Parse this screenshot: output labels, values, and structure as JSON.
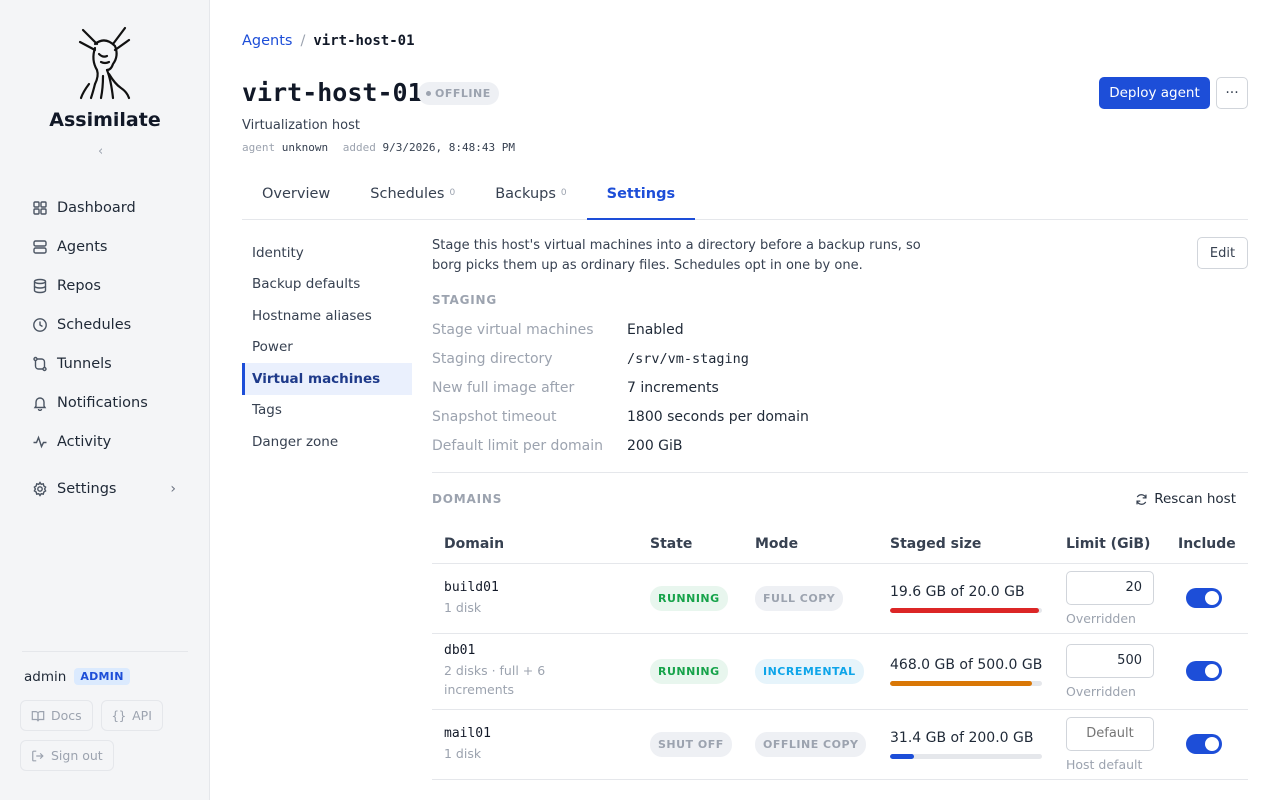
{
  "brand": {
    "name": "Assimilate",
    "collapse_glyph": "‹"
  },
  "sidebar": {
    "items": [
      {
        "label": "Dashboard",
        "icon": "dashboard-icon"
      },
      {
        "label": "Agents",
        "icon": "server-icon"
      },
      {
        "label": "Repos",
        "icon": "database-icon"
      },
      {
        "label": "Schedules",
        "icon": "clock-icon"
      },
      {
        "label": "Tunnels",
        "icon": "tunnel-icon"
      },
      {
        "label": "Notifications",
        "icon": "bell-icon"
      },
      {
        "label": "Activity",
        "icon": "activity-icon"
      },
      {
        "label": "Settings",
        "icon": "gear-icon"
      }
    ],
    "user": {
      "name": "admin",
      "role": "ADMIN"
    },
    "docs_label": "Docs",
    "api_label": "API",
    "signout_label": "Sign out"
  },
  "breadcrumb": {
    "parent": "Agents",
    "separator": "/",
    "current": "virt-host-01"
  },
  "header": {
    "title": "virt-host-01",
    "status": "OFFLINE",
    "subtitle": "Virtualization host",
    "meta": {
      "agent_key": "agent",
      "agent_value": "unknown",
      "added_key": "added",
      "added_value": "9/3/2026, 8:48:43 PM"
    },
    "deploy_label": "Deploy agent",
    "more_glyph": "···"
  },
  "tabs": [
    {
      "label": "Overview",
      "count": ""
    },
    {
      "label": "Schedules",
      "count": "0"
    },
    {
      "label": "Backups",
      "count": "0"
    },
    {
      "label": "Settings",
      "count": "",
      "active": true
    }
  ],
  "subnav": [
    "Identity",
    "Backup defaults",
    "Hostname aliases",
    "Power",
    "Virtual machines",
    "Tags",
    "Danger zone"
  ],
  "vm": {
    "description": "Stage this host's virtual machines into a directory before a backup runs, so borg picks them up as ordinary files. Schedules opt in one by one.",
    "edit_label": "Edit",
    "staging_label": "STAGING",
    "staging": [
      {
        "key": "Stage virtual machines",
        "value": "Enabled"
      },
      {
        "key": "Staging directory",
        "value": "/srv/vm-staging"
      },
      {
        "key": "New full image after",
        "value": "7 increments"
      },
      {
        "key": "Snapshot timeout",
        "value": "1800 seconds per domain"
      },
      {
        "key": "Default limit per domain",
        "value": "200 GiB"
      }
    ],
    "domains_label": "DOMAINS",
    "rescan_label": "Rescan host",
    "columns": [
      "Domain",
      "State",
      "Mode",
      "Staged size",
      "Limit (GiB)",
      "Include"
    ],
    "rows": [
      {
        "name": "build01",
        "sub": "1 disk",
        "state": "RUNNING",
        "mode": "FULL COPY",
        "size": "19.6 GB of 20.0 GB",
        "progress": 0.98,
        "bar_color": "#dc2626",
        "limit_value": "20",
        "limit_placeholder": "",
        "limit_note": "Overridden",
        "include": true
      },
      {
        "name": "db01",
        "sub": "2 disks · full + 6 increments",
        "state": "RUNNING",
        "mode": "INCREMENTAL",
        "size": "468.0 GB of 500.0 GB",
        "progress": 0.936,
        "bar_color": "#d97706",
        "limit_value": "500",
        "limit_placeholder": "",
        "limit_note": "Overridden",
        "include": true
      },
      {
        "name": "mail01",
        "sub": "1 disk",
        "state": "SHUT OFF",
        "mode": "OFFLINE COPY",
        "size": "31.4 GB of 200.0 GB",
        "progress": 0.157,
        "bar_color": "#1d4ed8",
        "limit_value": "",
        "limit_placeholder": "Default",
        "limit_note": "Host default",
        "include": true
      }
    ]
  }
}
